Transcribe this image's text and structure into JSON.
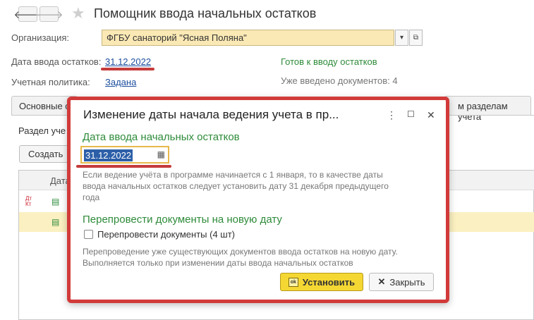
{
  "window": {
    "title": "Помощник ввода начальных остатков"
  },
  "form": {
    "org_label": "Организация:",
    "org_value": "ФГБУ санаторий \"Ясная Поляна\"",
    "date_label": "Дата ввода остатков:",
    "date_value": "31.12.2022",
    "policy_label": "Учетная политика:",
    "policy_value": "Задана",
    "status_ready": "Готов к вводу остатков",
    "docs_entered": "Уже введено документов: 4"
  },
  "tabs": {
    "main_label": "Основные с",
    "sections_label": "м разделам учета"
  },
  "background": {
    "section_label": "Раздел уче",
    "create_label": "Создать",
    "col_date": "Дата",
    "dt_kt": "Дт Кт"
  },
  "dialog": {
    "title": "Изменение даты начала ведения учета в пр...",
    "date_section": "Дата ввода начальных остатков",
    "date_value": "31.12.2022",
    "date_hint_1": "Если ведение учёта в программе начинается с 1 января, то в качестве даты",
    "date_hint_2": "ввода начальных остатков следует установить дату 31 декабря предыдущего",
    "date_hint_3": "года",
    "repost_section": "Перепровести документы на новую дату",
    "repost_checkbox": "Перепровести документы (4 шт)",
    "repost_hint_1": "Перепроведение уже существующих документов ввода остатков на новую дату.",
    "repost_hint_2": "Выполняется только при изменении даты ввода начальных остатков",
    "ok_label": "Установить",
    "close_label": "Закрыть"
  },
  "colors": {
    "accent_green": "#2e8b3a",
    "highlight_red": "#d23a3a",
    "ok_yellow": "#f5d733"
  }
}
